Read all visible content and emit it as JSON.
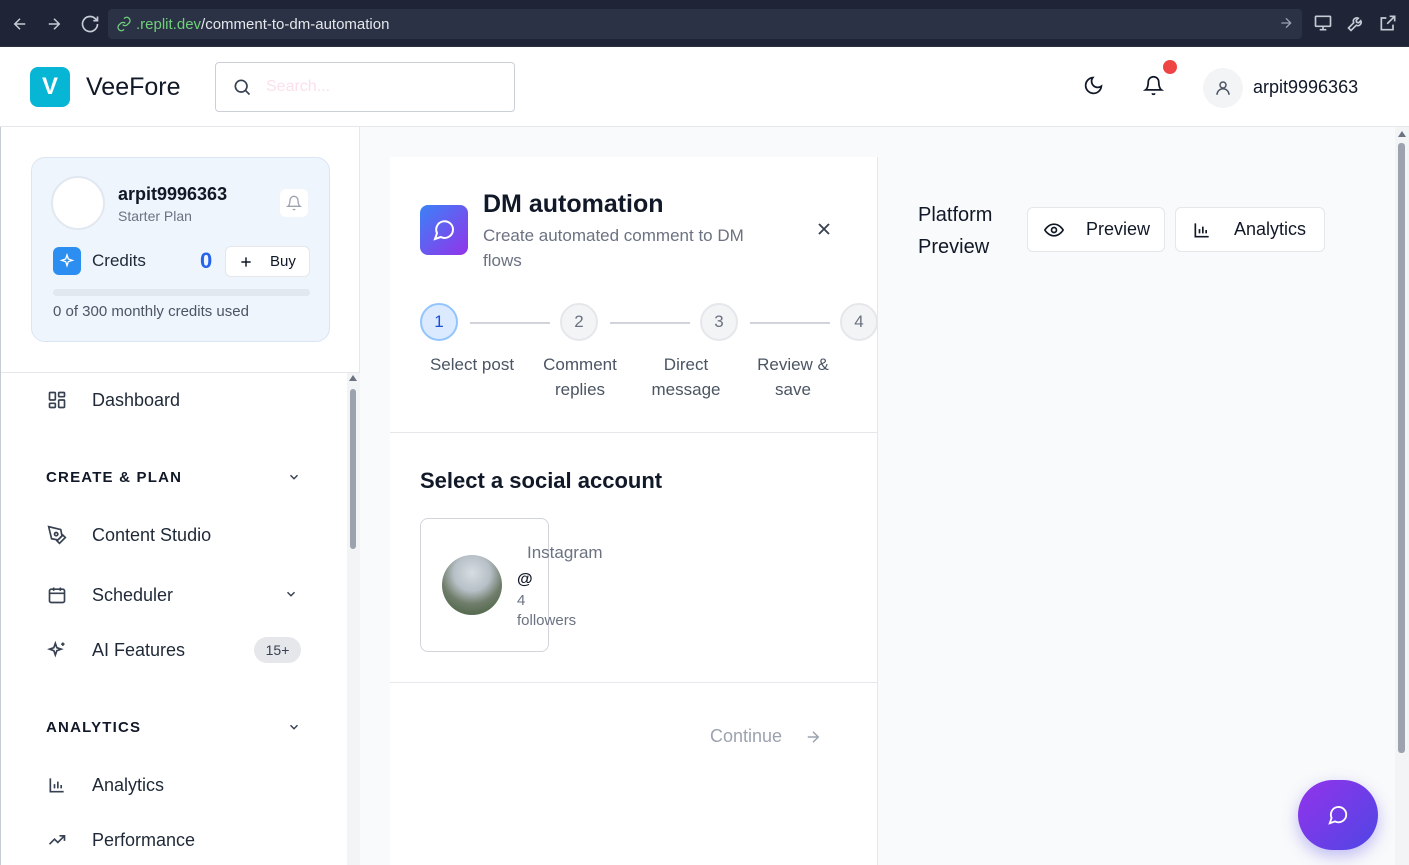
{
  "browser": {
    "url_host": ".replit.dev",
    "url_path": "/comment-to-dm-automation"
  },
  "header": {
    "brand_letter": "V",
    "brand_name": "VeeFore",
    "search_placeholder": "Search...",
    "username": "arpit9996363"
  },
  "sidebar": {
    "profile": {
      "name": "arpit9996363",
      "plan": "Starter Plan",
      "credits_label": "Credits",
      "credits_value": "0",
      "buy_label": "Buy",
      "usage_text": "0 of 300 monthly credits used",
      "usage_fraction": 0
    },
    "items": {
      "dashboard": "Dashboard",
      "create_plan": "CREATE & PLAN",
      "content_studio": "Content Studio",
      "scheduler": "Scheduler",
      "ai_features": "AI Features",
      "ai_features_badge": "15+",
      "analytics_section": "ANALYTICS",
      "analytics": "Analytics",
      "performance": "Performance"
    }
  },
  "wizard": {
    "title": "DM automation",
    "subtitle": "Create automated comment to DM flows",
    "steps": [
      {
        "number": "1",
        "label": "Select post"
      },
      {
        "number": "2",
        "label": "Comment replies"
      },
      {
        "number": "3",
        "label": "Direct message"
      },
      {
        "number": "4",
        "label": "Review & save"
      }
    ],
    "select_title": "Select a social account",
    "account": {
      "platform": "Instagram",
      "handle": "@",
      "followers": "4 followers"
    },
    "continue_label": "Continue"
  },
  "preview": {
    "title_line1": "Platform",
    "title_line2": "Preview",
    "preview_button": "Preview",
    "analytics_button": "Analytics"
  },
  "colors": {
    "accent": "#06b6d4",
    "primary_blue": "#2563eb",
    "notification": "#ef4444",
    "gradient_start": "#3b82f6",
    "gradient_end": "#9333ea"
  }
}
